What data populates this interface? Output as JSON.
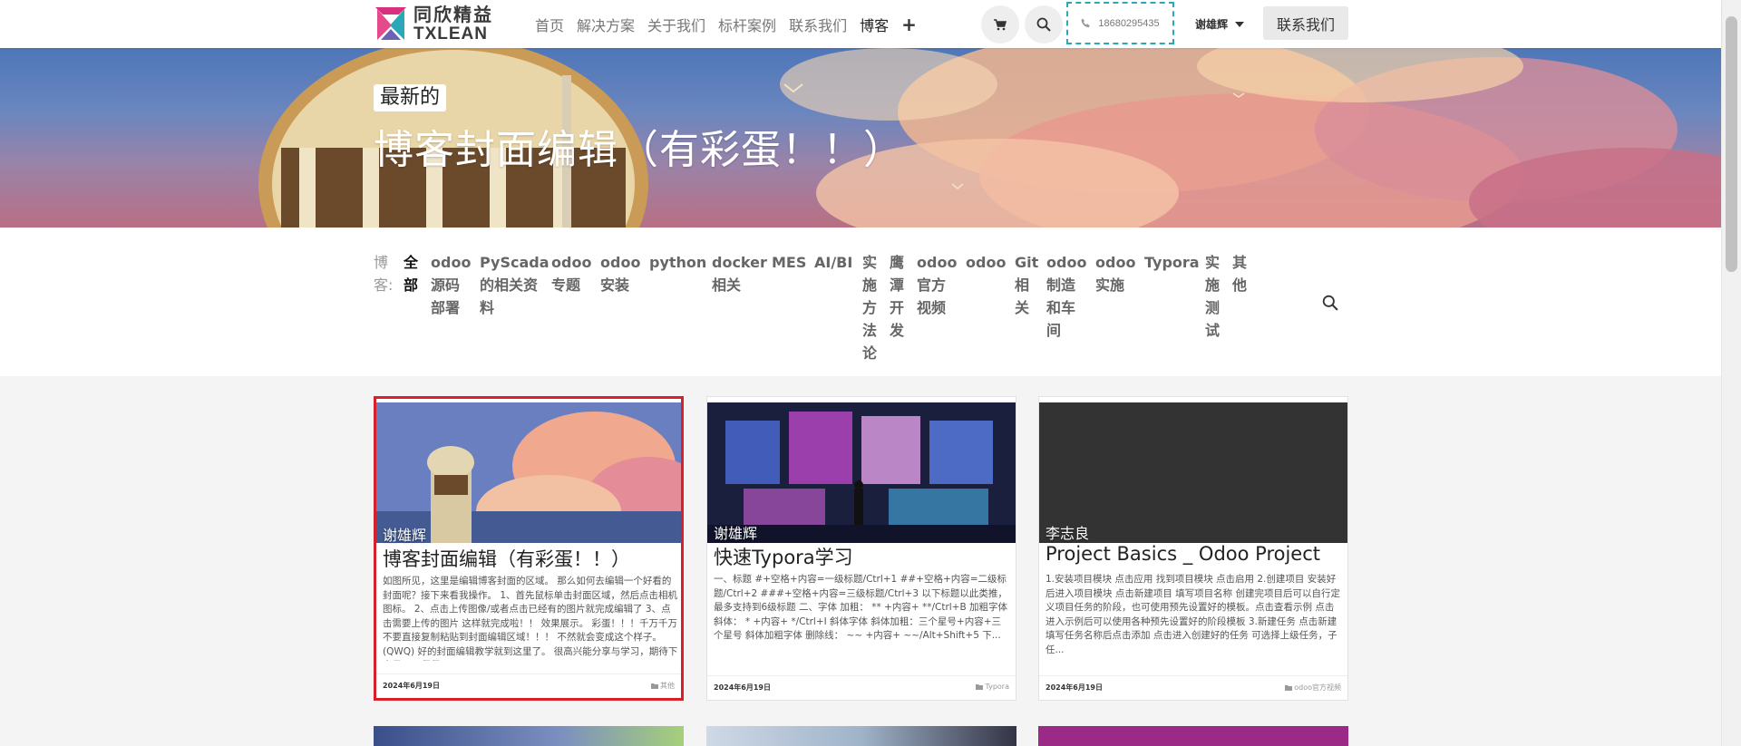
{
  "brand": {
    "name_cn": "同欣精益",
    "name_en": "TXLEAN",
    "colors": {
      "pink": "#d9307e",
      "teal": "#29a9b8",
      "dark": "#3a3a3a"
    }
  },
  "nav": {
    "items": [
      {
        "label": "首页",
        "active": false
      },
      {
        "label": "解决方案",
        "active": false
      },
      {
        "label": "关于我们",
        "active": false
      },
      {
        "label": "标杆案例",
        "active": false
      },
      {
        "label": "联系我们",
        "active": false
      },
      {
        "label": "博客",
        "active": true
      }
    ],
    "plus": "+",
    "cart_icon": "cart-icon",
    "search_icon": "search-icon",
    "phone": "18680295435",
    "user": "谢雄辉",
    "contact_button": "联系我们"
  },
  "hero": {
    "badge": "最新的",
    "title": "博客封面编辑（有彩蛋！！）"
  },
  "filter": {
    "label": "博客:",
    "tags": [
      {
        "label": "全部",
        "active": true
      },
      {
        "label": "odoo源码部署",
        "active": false
      },
      {
        "label": "PyScada的相关资料",
        "active": false
      },
      {
        "label": "odoo专题",
        "active": false
      },
      {
        "label": "odoo安装",
        "active": false
      },
      {
        "label": "python",
        "active": false
      },
      {
        "label": "docker相关",
        "active": false
      },
      {
        "label": "MES",
        "active": false
      },
      {
        "label": "AI/BI",
        "active": false
      },
      {
        "label": "实施方法论",
        "active": false
      },
      {
        "label": "鹰潭开发",
        "active": false
      },
      {
        "label": "odoo官方视频",
        "active": false
      },
      {
        "label": "odoo",
        "active": false
      },
      {
        "label": "Git相关",
        "active": false
      },
      {
        "label": "odoo制造和车间",
        "active": false
      },
      {
        "label": "odoo实施",
        "active": false
      },
      {
        "label": "Typora",
        "active": false
      },
      {
        "label": "实施测试",
        "active": false
      },
      {
        "label": "其他",
        "active": false
      }
    ]
  },
  "cards": [
    {
      "author": "谢雄辉",
      "title": "博客封面编辑（有彩蛋！！）",
      "excerpt": "如图所见，这里是编辑博客封面的区域。 那么如何去编辑一个好看的封面呢？接下来看我操作。 1、首先鼠标单击封面区域，然后点击相机图标。 2、点击上传图像/或者点击已经有的图片就完成编辑了 3、点击需要上传的图片 这样就完成啦！！ 效果展示。 彩蛋！！！千万千万不要直接复制粘贴到封面编辑区域！！！ 不然就会变成这个样子。(QWQ) 好的封面编辑教学就到这里了。 很高兴能分享与学习，期待下次见面，拜拜...",
      "date": "2024年6月19日",
      "category": "其他"
    },
    {
      "author": "谢雄辉",
      "title": "快速Typora学习",
      "excerpt": "一、标题 #+空格+内容=一级标题/Ctrl+1 ##+空格+内容=二级标题/Ctrl+2 ###+空格+内容=三级标题/Ctrl+3 以下标题以此类推，最多支持到6级标题 二、字体 加粗： ** +内容+ **/Ctrl+B 加粗字体 斜体： * +内容+ */Ctrl+I 斜体字体 斜体加粗：三个星号+内容+三个星号 斜体加粗字体 删除线： ~~ +内容+ ~~/Alt+Shift+5 下...",
      "date": "2024年6月19日",
      "category": "Typora"
    },
    {
      "author": "李志良",
      "title": "Project Basics _ Odoo Project",
      "excerpt": "1.安装项目模块 点击应用 找到项目模块 点击启用 2.创建项目 安装好后进入项目模块 点击新建项目 填写项目名称 创建完项目后可以自行定义项目任务的阶段，也可使用预先设置好的模板。点击查看示例 点击进入示例后可以使用各种预先设置好的阶段模板 3.新建任务 点击新建 填写任务名称后点击添加 点击进入创建好的任务 可选择上级任务，子任...",
      "date": "2024年6月19日",
      "category": "odoo官方视频"
    }
  ]
}
